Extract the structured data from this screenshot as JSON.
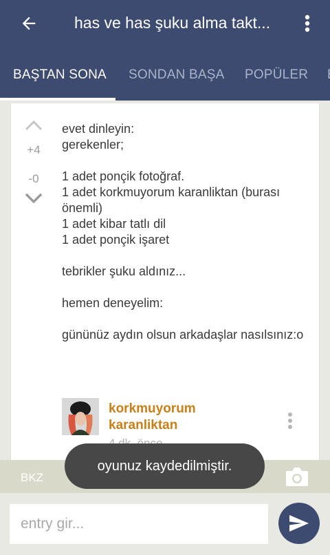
{
  "app": {
    "title": "has ve has şuku alma takt..."
  },
  "tabs": [
    {
      "label": "BAŞTAN SONA",
      "active": true
    },
    {
      "label": "SONDAN BAŞA",
      "active": false
    },
    {
      "label": "POPÜLER",
      "active": false
    },
    {
      "label": "B",
      "active": false
    }
  ],
  "entry": {
    "upvotes": "+4",
    "downvotes": "-0",
    "text": "evet dinleyin:\ngerekenler;\n\n1 adet ponçik fotoğraf.\n1 adet korkmuyorum karanliktan (burası önemli)\n1 adet kibar tatlı dil\n1 adet ponçik işaret\n\ntebrikler şuku aldınız...\n\nhemen deneyelim:\n\ngününüz aydın olsun arkadaşlar nasılsınız:o",
    "author": "korkmuyorum karanliktan",
    "date": "4 dk. önce"
  },
  "toolbar": {
    "bkz_label": "BKZ"
  },
  "toast": {
    "message": "oyunuz kaydedilmiştir."
  },
  "compose": {
    "placeholder": "entry gir..."
  },
  "icons": {
    "back": "arrow-left-icon",
    "menu": "more-vert-icon",
    "upvote": "chevron-up-icon",
    "downvote": "chevron-down-icon",
    "more": "more-vert-icon",
    "camera": "camera-icon",
    "send": "send-icon"
  },
  "colors": {
    "appbar": "#3d4b70",
    "author": "#c98018",
    "bkz_bar": "#d9d9c9",
    "toast": "#474747"
  }
}
